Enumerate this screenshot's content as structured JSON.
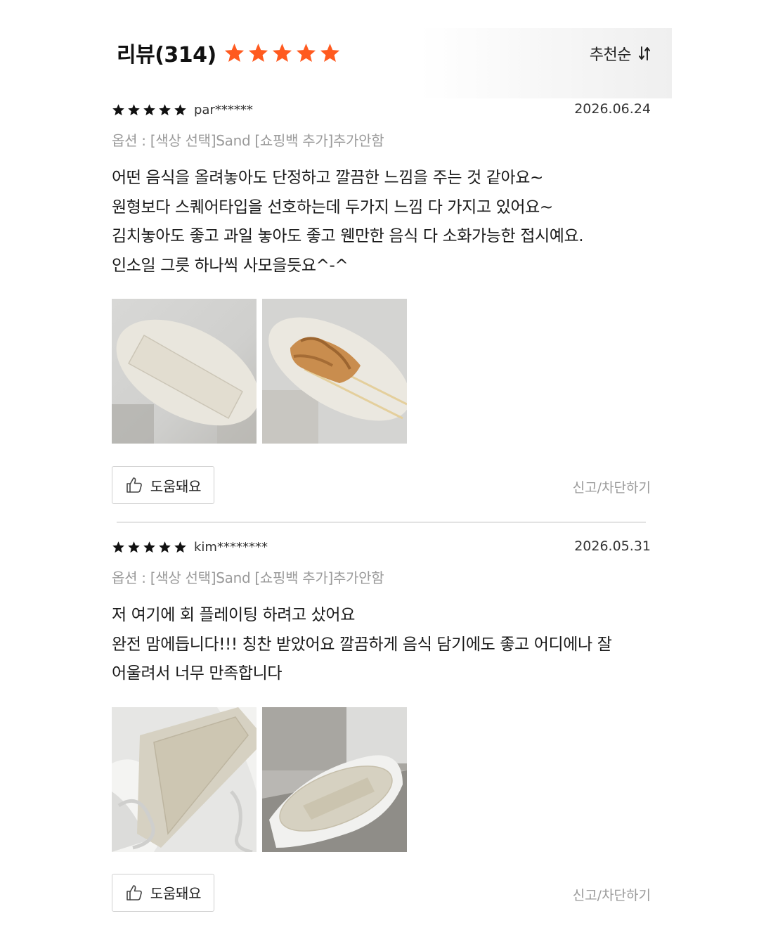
{
  "header": {
    "title": "리뷰(314)",
    "rating_stars": 5,
    "star_color": "#ff5a1f",
    "sort_label": "추천순",
    "sort_icon": "sort-arrows-icon"
  },
  "reviews": [
    {
      "stars": 5,
      "username": "par******",
      "date": "2026.06.24",
      "option": "옵션 : [색상 선택]Sand [쇼핑백 추가]추가안함",
      "lines": [
        "어떤 음식을 올려놓아도 단정하고 깔끔한 느낌을 주는 것 같아요~",
        "원형보다 스퀘어타입을 선호하는데 두가지 느낌 다 가지고 있어요~",
        "김치놓아도 좋고 과일 놓아도 좋고 웬만한 음식 다 소화가능한 접시예요.",
        "인소일 그릇 하나씩 사모을듯요^-^"
      ],
      "photos": [
        "empty-oval-plate-photo",
        "plate-with-fishcake-skewers-photo"
      ],
      "helpful_label": "도움돼요",
      "report_label": "신고/차단하기"
    },
    {
      "stars": 5,
      "username": "kim********",
      "date": "2026.05.31",
      "option": "옵션 : [색상 선택]Sand [쇼핑백 추가]추가안함",
      "lines": [
        "저 여기에 회 플레이팅 하려고 샀어요",
        "완전 맘에듭니다!!! 칭찬 받았어요 깔끔하게 음식 담기에도 좋고 어디에나 잘",
        "어울려서 너무 만족합니다"
      ],
      "photos": [
        "plate-in-packaging-photo",
        "plate-in-box-photo"
      ],
      "helpful_label": "도움돼요",
      "report_label": "신고/차단하기"
    }
  ]
}
